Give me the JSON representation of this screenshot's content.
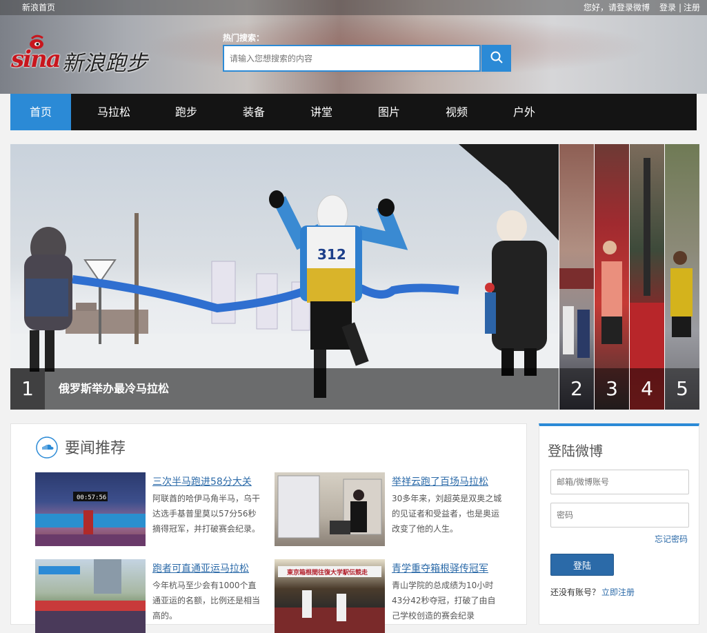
{
  "topbar": {
    "home": "新浪首页",
    "greeting": "您好，请登录微博",
    "login": "登录",
    "separator": "|",
    "register": "注册"
  },
  "logo": {
    "sina": "sina",
    "text": "新浪跑步"
  },
  "search": {
    "hot_label": "热门搜索：",
    "placeholder": "请输入您想搜索的内容",
    "button_icon": "search-icon"
  },
  "nav": {
    "items": [
      {
        "label": "首页",
        "active": true
      },
      {
        "label": "马拉松"
      },
      {
        "label": "跑步"
      },
      {
        "label": "装备"
      },
      {
        "label": "讲堂"
      },
      {
        "label": "图片"
      },
      {
        "label": "视频"
      },
      {
        "label": "户外"
      }
    ]
  },
  "slider": {
    "current": "1",
    "caption": "俄罗斯举办最冷马拉松",
    "bib": "312",
    "thumbs": [
      "2",
      "3",
      "4",
      "5"
    ]
  },
  "news": {
    "icon": "soundcloud-icon",
    "title": "要闻推荐",
    "items": [
      {
        "title": "三次半马跑进58分大关",
        "desc": "阿联酋的哈伊马角半马，乌干达选手基普里莫以57分56秒摘得冠军，并打破赛会纪录。",
        "img_text": "00:57:56"
      },
      {
        "title": "举祥云跑了百场马拉松",
        "desc": "30多年来，刘超英是双奥之城的见证者和受益者，也是奥运改变了他的人生。"
      },
      {
        "title": "跑者可直通亚运马拉松",
        "desc": "今年杭马至少会有1000个直通亚运的名额，比例还是相当高的。"
      },
      {
        "title": "青学重夺箱根驿传冠军",
        "desc": "青山学院的总成绩为10小时43分42秒夺冠，打破了由自己学校创造的赛会纪录",
        "img_text": "東京箱根間往復大学駅伝競走"
      }
    ]
  },
  "login": {
    "title": "登陆微博",
    "account_placeholder": "邮箱/微博账号",
    "password_placeholder": "密码",
    "forgot": "忘记密码",
    "button": "登陆",
    "no_account": "还没有账号？",
    "register_now": "立即注册"
  },
  "colors": {
    "accent": "#2b8ad6",
    "nav_bg": "#141414",
    "link": "#2b6aa8"
  }
}
